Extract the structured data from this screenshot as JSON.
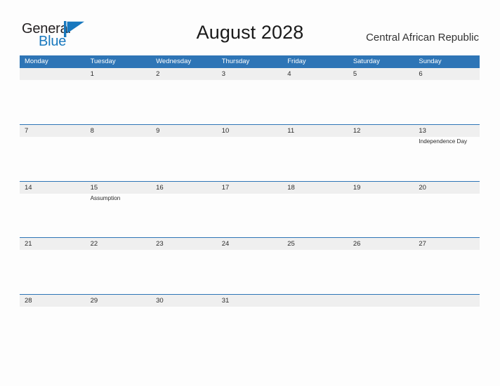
{
  "brand": {
    "name_part1": "General",
    "name_part2": "Blue",
    "logo_icon": "flag-triangle-icon",
    "color_dark": "#231f20",
    "color_blue": "#1878be"
  },
  "header": {
    "title": "August 2028",
    "region": "Central African Republic"
  },
  "theme": {
    "header_bar_color": "#2e75b6",
    "row_divider_color": "#2e75b6",
    "date_band_color": "#efefef",
    "page_background": "#fdfdfd",
    "text_color": "#2b2b2b"
  },
  "calendar": {
    "month": "August",
    "year": "2028",
    "weekdays": [
      "Monday",
      "Tuesday",
      "Wednesday",
      "Thursday",
      "Friday",
      "Saturday",
      "Sunday"
    ],
    "weeks": [
      {
        "days": [
          {
            "number": "",
            "events": []
          },
          {
            "number": "1",
            "events": []
          },
          {
            "number": "2",
            "events": []
          },
          {
            "number": "3",
            "events": []
          },
          {
            "number": "4",
            "events": []
          },
          {
            "number": "5",
            "events": []
          },
          {
            "number": "6",
            "events": []
          }
        ]
      },
      {
        "days": [
          {
            "number": "7",
            "events": []
          },
          {
            "number": "8",
            "events": []
          },
          {
            "number": "9",
            "events": []
          },
          {
            "number": "10",
            "events": []
          },
          {
            "number": "11",
            "events": []
          },
          {
            "number": "12",
            "events": []
          },
          {
            "number": "13",
            "events": [
              "Independence Day"
            ]
          }
        ]
      },
      {
        "days": [
          {
            "number": "14",
            "events": []
          },
          {
            "number": "15",
            "events": [
              "Assumption"
            ]
          },
          {
            "number": "16",
            "events": []
          },
          {
            "number": "17",
            "events": []
          },
          {
            "number": "18",
            "events": []
          },
          {
            "number": "19",
            "events": []
          },
          {
            "number": "20",
            "events": []
          }
        ]
      },
      {
        "days": [
          {
            "number": "21",
            "events": []
          },
          {
            "number": "22",
            "events": []
          },
          {
            "number": "23",
            "events": []
          },
          {
            "number": "24",
            "events": []
          },
          {
            "number": "25",
            "events": []
          },
          {
            "number": "26",
            "events": []
          },
          {
            "number": "27",
            "events": []
          }
        ]
      },
      {
        "days": [
          {
            "number": "28",
            "events": []
          },
          {
            "number": "29",
            "events": []
          },
          {
            "number": "30",
            "events": []
          },
          {
            "number": "31",
            "events": []
          },
          {
            "number": "",
            "events": []
          },
          {
            "number": "",
            "events": []
          },
          {
            "number": "",
            "events": []
          }
        ]
      }
    ]
  }
}
